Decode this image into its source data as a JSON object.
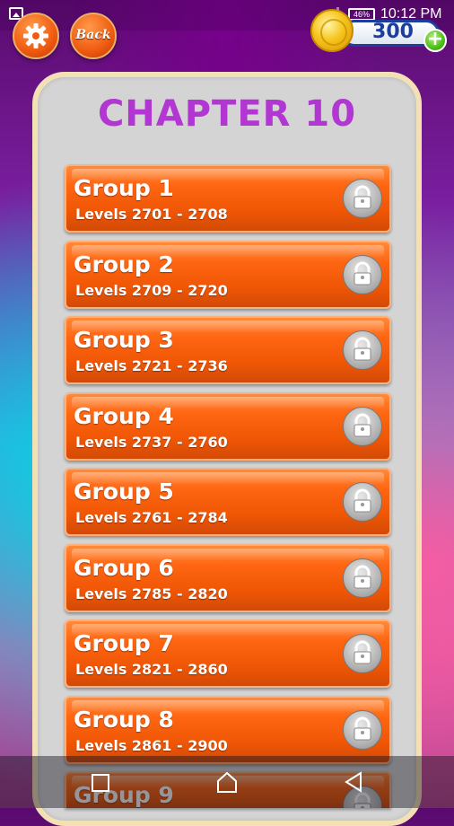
{
  "status_bar": {
    "battery": "46%",
    "time": "10:12 PM"
  },
  "top_bar": {
    "back_label": "Back",
    "coins": "300"
  },
  "chapter": {
    "title": "CHAPTER 10"
  },
  "groups": [
    {
      "name": "Group 1",
      "levels": "Levels 2701 - 2708"
    },
    {
      "name": "Group 2",
      "levels": "Levels 2709 - 2720"
    },
    {
      "name": "Group 3",
      "levels": "Levels 2721 - 2736"
    },
    {
      "name": "Group 4",
      "levels": "Levels 2737 - 2760"
    },
    {
      "name": "Group 5",
      "levels": "Levels 2761 - 2784"
    },
    {
      "name": "Group 6",
      "levels": "Levels 2785 - 2820"
    },
    {
      "name": "Group 7",
      "levels": "Levels 2821 - 2860"
    },
    {
      "name": "Group 8",
      "levels": "Levels 2861 - 2900"
    },
    {
      "name": "Group 9",
      "levels": ""
    }
  ],
  "icons": {
    "settings": "gear-icon",
    "lock": "lock-icon",
    "coin": "coin-icon",
    "add": "plus-icon",
    "nav_recent": "square-icon",
    "nav_home": "home-icon",
    "nav_back": "triangle-back-icon"
  },
  "colors": {
    "title": "#b236d2",
    "group_button": "#ef5605",
    "panel": "#d4d4d4",
    "coin_border": "#1c3f9e"
  }
}
